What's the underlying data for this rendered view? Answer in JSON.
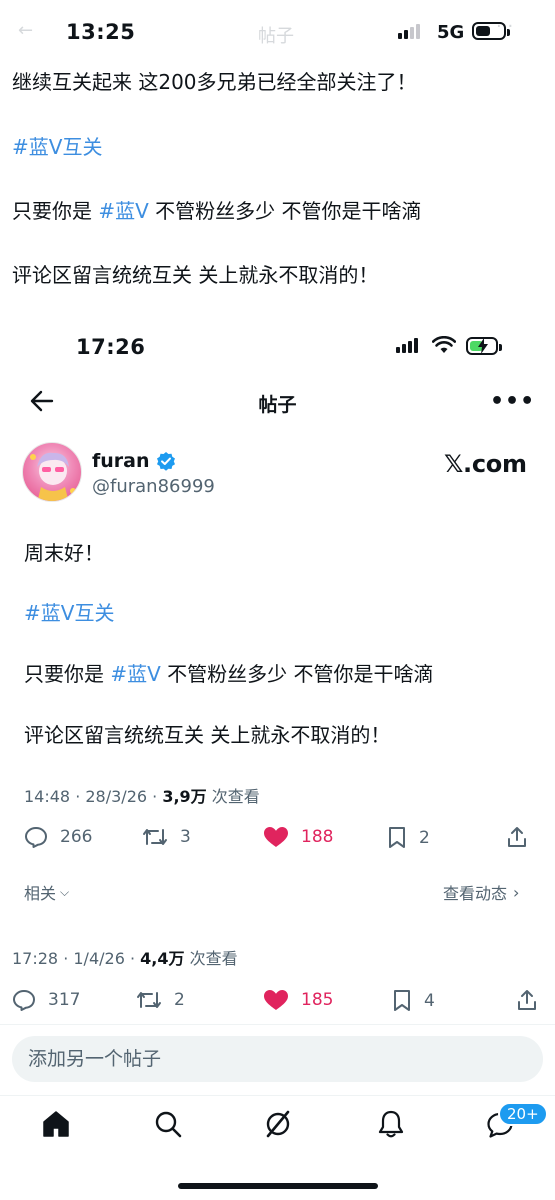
{
  "top_status": {
    "time": "13:25",
    "network": "5G",
    "ghost_title": "帖子"
  },
  "top_post": {
    "line1": "继续互关起来 这200多兄弟已经全部关注了！",
    "hashtag": "#蓝V互关",
    "line3_pre": "只要你是 ",
    "line3_tag": "#蓝V",
    "line3_post": " 不管粉丝多少 不管你是干啥滴",
    "line4": "评论区留言统统互关 关上就永不取消的！"
  },
  "inner_status": {
    "time": "17:26"
  },
  "header": {
    "title": "帖子"
  },
  "author": {
    "name": "furan",
    "handle": "@furan86999",
    "watermark": "𝕏.com"
  },
  "inner_post": {
    "line1": "周末好！",
    "hashtag": "#蓝V互关",
    "line3_pre": "只要你是 ",
    "line3_tag": "#蓝V",
    "line3_post": " 不管粉丝多少 不管你是干啥滴",
    "line4": "评论区留言统统互关 关上就永不取消的！"
  },
  "inner_meta": {
    "time_date": "14:48 · 28/3/26 · ",
    "views": "3,9万",
    "views_label": " 次查看"
  },
  "inner_actions": {
    "replies": "266",
    "reposts": "3",
    "likes": "188",
    "bookmarks": "2"
  },
  "related": {
    "label": "相关",
    "activity": "查看动态"
  },
  "outer_meta": {
    "time_date": "17:28 · 1/4/26 · ",
    "views": "4,4万",
    "views_label": " 次查看"
  },
  "outer_actions": {
    "replies": "317",
    "reposts": "2",
    "likes": "185",
    "bookmarks": "4"
  },
  "compose": {
    "placeholder": "添加另一个帖子"
  },
  "nav": {
    "badge": "20+"
  },
  "colors": {
    "accent": "#1d9bf0",
    "hashtag": "#3d8ee0",
    "like": "#e0245e",
    "verified": "#1d9bf0",
    "battery_green": "#4cd964"
  }
}
